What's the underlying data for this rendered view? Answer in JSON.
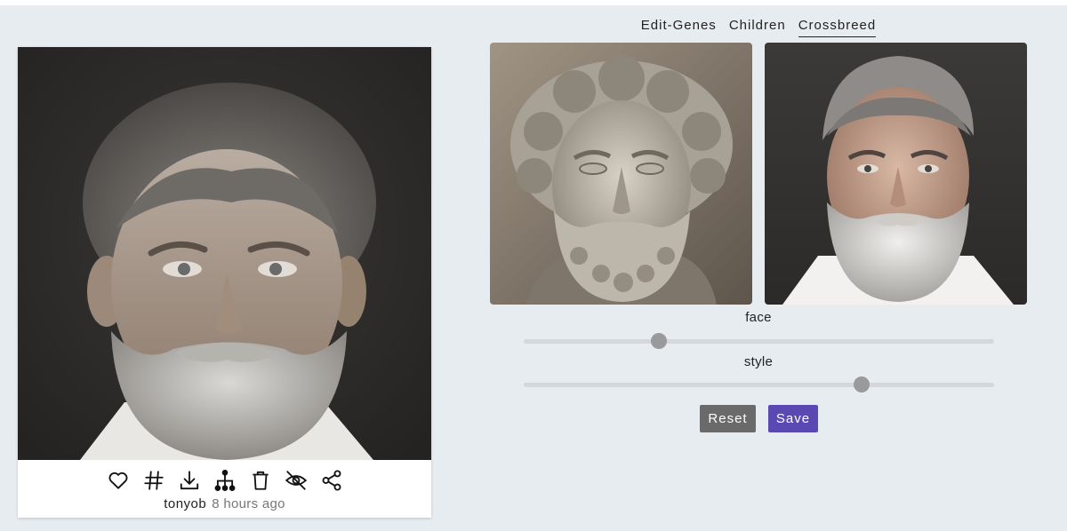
{
  "tabs": [
    {
      "label": "Edit-Genes",
      "active": false
    },
    {
      "label": "Children",
      "active": false
    },
    {
      "label": "Crossbreed",
      "active": true
    }
  ],
  "main_image": {
    "subject": "portrait of a grey-haired bearded man"
  },
  "actions": [
    {
      "icon": "heart-icon"
    },
    {
      "icon": "hashtag-icon"
    },
    {
      "icon": "download-icon"
    },
    {
      "icon": "family-tree-icon"
    },
    {
      "icon": "trash-icon"
    },
    {
      "icon": "hidden-eye-icon"
    },
    {
      "icon": "share-icon"
    }
  ],
  "author": {
    "username": "tonyob",
    "time": "8 hours ago"
  },
  "parents": [
    {
      "subject": "marble statue bust with curly hair and beard"
    },
    {
      "subject": "photo of grey-haired man with white beard"
    }
  ],
  "sliders": {
    "face": {
      "label": "face",
      "value": 0.287
    },
    "style": {
      "label": "style",
      "value": 0.718
    }
  },
  "buttons": {
    "reset": "Reset",
    "save": "Save"
  },
  "colors": {
    "background": "#e7ecf0",
    "save_button": "#5a49b2",
    "reset_button": "#6a6a6a",
    "slider_thumb": "#9a9a9a"
  }
}
